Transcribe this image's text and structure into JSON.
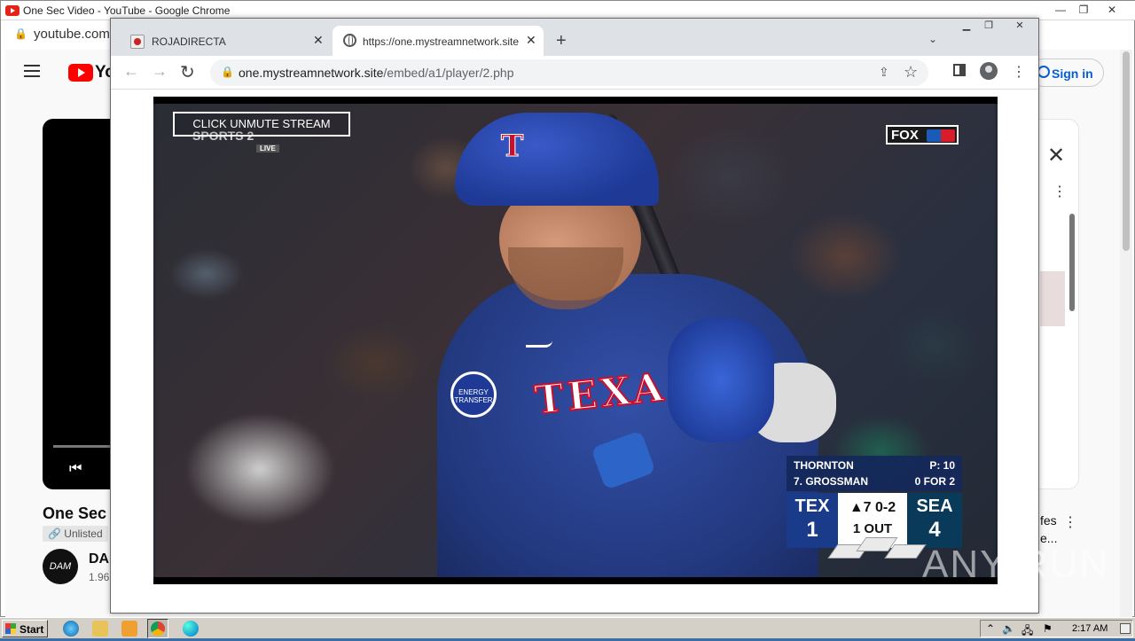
{
  "background_window": {
    "title": "One Sec Video - YouTube - Google Chrome",
    "url_partial": "youtube.com/",
    "youtube": {
      "logo_text": "Yo",
      "sign_in": "Sign in",
      "video_title": "One Sec",
      "unlisted": "Unlisted",
      "avatar_text": "DAM",
      "channel_name": "DA",
      "subscribers": "1.96",
      "suggestion_text_line1": "fes",
      "suggestion_text_line2": "e..."
    }
  },
  "popup_window": {
    "tabs": [
      {
        "label": "ROJADIRECTA",
        "active": false
      },
      {
        "label": "https://one.mystreamnetwork.site/e",
        "active": true
      }
    ],
    "omnibox": {
      "host": "one.mystreamnetwork.site",
      "path": "/embed/a1/player/2.php"
    }
  },
  "video": {
    "unmute_label": "CLICK UNMUTE STREAM",
    "network_logo": "SPORTS 2",
    "network_live": "LIVE",
    "broadcaster": "FOX",
    "helmet_letter": "T",
    "jersey_text": "TEXA",
    "patch_text": "ENERGY TRANSFER",
    "scoreboard": {
      "pitcher": "THORNTON",
      "pitch_count": "P: 10",
      "batter": "7. GROSSMAN",
      "batter_stats": "0 FOR 2",
      "away_team": "TEX",
      "away_score": "1",
      "inning": "▲7 0-2",
      "outs": "1 OUT",
      "home_team": "SEA",
      "home_score": "4"
    }
  },
  "watermark": "ANY RUN",
  "taskbar": {
    "start_label": "Start",
    "clock": "2:17 AM"
  }
}
